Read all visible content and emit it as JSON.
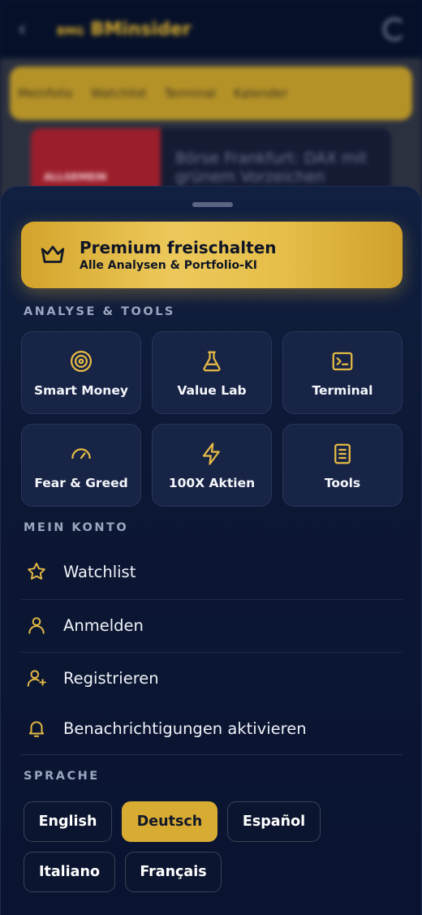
{
  "background": {
    "logo_small": "BMG",
    "logo": "BMinsider",
    "nav": [
      "Meinfolio",
      "Watchlist",
      "Terminal",
      "Kalender"
    ],
    "card_tag": "ALLGEMEIN",
    "card_headline": "Börse Frankfurt: DAX mit grünem Vorzeichen"
  },
  "premium": {
    "title": "Premium freischalten",
    "subtitle": "Alle Analysen & Portfolio-KI"
  },
  "sections": {
    "tools": "ANALYSE & TOOLS",
    "account": "MEIN KONTO",
    "language": "SPRACHE"
  },
  "tools": [
    {
      "label": "Smart Money",
      "icon": "target-icon"
    },
    {
      "label": "Value Lab",
      "icon": "flask-icon"
    },
    {
      "label": "Terminal",
      "icon": "terminal-icon"
    },
    {
      "label": "Fear & Greed",
      "icon": "gauge-icon"
    },
    {
      "label": "100X Aktien",
      "icon": "lightning-icon"
    },
    {
      "label": "Tools",
      "icon": "document-icon"
    }
  ],
  "account": [
    {
      "label": "Watchlist",
      "icon": "star-icon"
    },
    {
      "label": "Anmelden",
      "icon": "user-icon"
    },
    {
      "label": "Registrieren",
      "icon": "user-plus-icon"
    },
    {
      "label": "Benachrichtigungen aktivieren",
      "icon": "bell-icon"
    }
  ],
  "languages": [
    {
      "label": "English",
      "selected": false
    },
    {
      "label": "Deutsch",
      "selected": true
    },
    {
      "label": "Español",
      "selected": false
    },
    {
      "label": "Italiano",
      "selected": false
    },
    {
      "label": "Français",
      "selected": false
    }
  ],
  "colors": {
    "accent": "#e6bb45",
    "sheet_background": "#0c1733",
    "tile_background": "#182445",
    "selected_language": "#d8ab33"
  }
}
